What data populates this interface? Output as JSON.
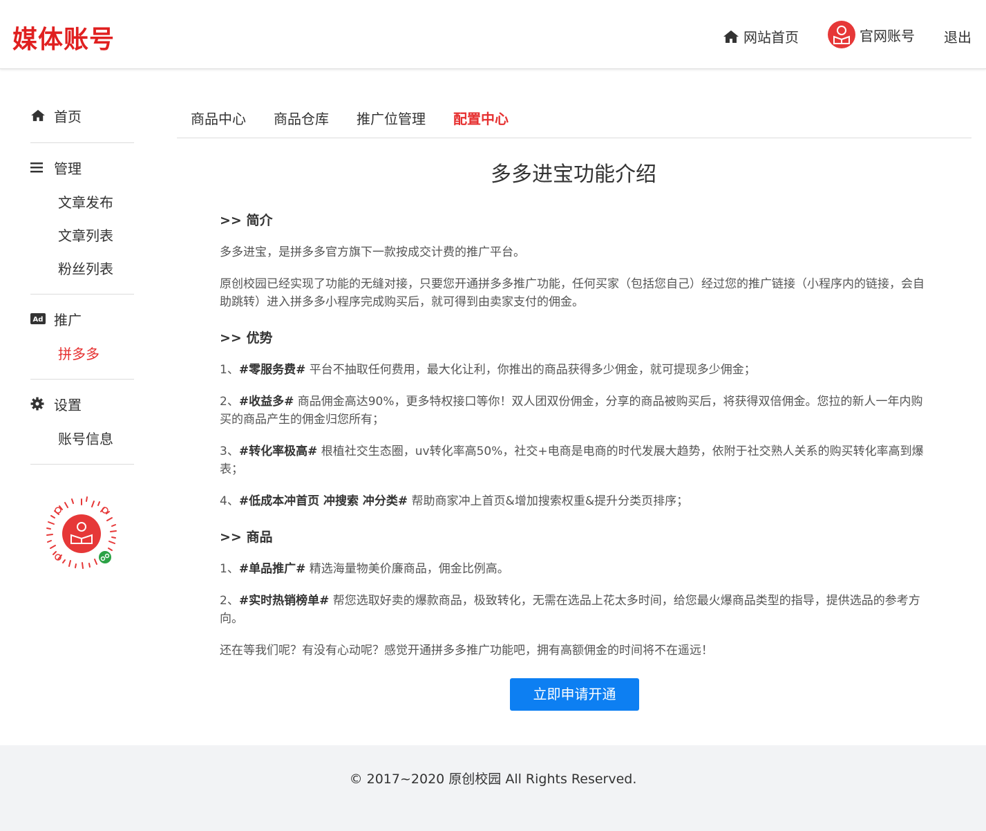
{
  "header": {
    "brand": "媒体账号",
    "home_label": "网站首页",
    "account_label": "官网账号",
    "logout_label": "退出"
  },
  "sidebar": {
    "home": "首页",
    "manage": "管理",
    "manage_items": [
      "文章发布",
      "文章列表",
      "粉丝列表"
    ],
    "promo": "推广",
    "promo_items": [
      "拼多多"
    ],
    "settings": "设置",
    "settings_items": [
      "账号信息"
    ],
    "ad_badge": "Ad"
  },
  "tabs": [
    "商品中心",
    "商品仓库",
    "推广位管理",
    "配置中心"
  ],
  "active_tab": "配置中心",
  "main": {
    "title": "多多进宝功能介绍",
    "intro_heading": ">> 简介",
    "intro_p1": "多多进宝，是拼多多官方旗下一款按成交计费的推广平台。",
    "intro_p2": "原创校园已经实现了功能的无缝对接，只要您开通拼多多推广功能，任何买家（包括您自己）经过您的推广链接（小程序内的链接，会自助跳转）进入拼多多小程序完成购买后，就可得到由卖家支付的佣金。",
    "adv_heading": ">> 优势",
    "adv": [
      {
        "prefix": "1、",
        "tag": "#零服务费#",
        "text": " 平台不抽取任何费用，最大化让利，你推出的商品获得多少佣金，就可提现多少佣金；"
      },
      {
        "prefix": "2、",
        "tag": "#收益多#",
        "text": " 商品佣金高达90%，更多特权接口等你！双人团双份佣金，分享的商品被购买后，将获得双倍佣金。您拉的新人一年内购买的商品产生的佣金归您所有；"
      },
      {
        "prefix": "3、",
        "tag": "#转化率极高#",
        "text": " 根植社交生态圈，uv转化率高50%，社交+电商是电商的时代发展大趋势，依附于社交熟人关系的购买转化率高到爆表；"
      },
      {
        "prefix": "4、",
        "tag": "#低成本冲首页 冲搜索 冲分类#",
        "text": " 帮助商家冲上首页&增加搜索权重&提升分类页排序；"
      }
    ],
    "goods_heading": ">> 商品",
    "goods": [
      {
        "prefix": "1、",
        "tag": "#单品推广#",
        "text": " 精选海量物美价廉商品，佣金比例高。"
      },
      {
        "prefix": "2、",
        "tag": "#实时热销榜单#",
        "text": " 帮您选取好卖的爆款商品，极致转化，无需在选品上花太多时间，给您最火爆商品类型的指导，提供选品的参考方向。"
      }
    ],
    "closing": "还在等我们呢？有没有心动呢？感觉开通拼多多推广功能吧，拥有高额佣金的时间将不在遥远！",
    "apply_button": "立即申请开通"
  },
  "footer": {
    "copyright": "© 2017~2020 原创校园 All Rights Reserved."
  },
  "colors": {
    "brand_red": "#e02020",
    "active_red": "#e63030",
    "button_blue": "#0d7ff2",
    "footer_bg": "#f2f3f5"
  },
  "icons": [
    "home-icon",
    "user-avatar-icon",
    "menu-icon",
    "ad-icon",
    "gear-icon",
    "qr-code-icon"
  ]
}
